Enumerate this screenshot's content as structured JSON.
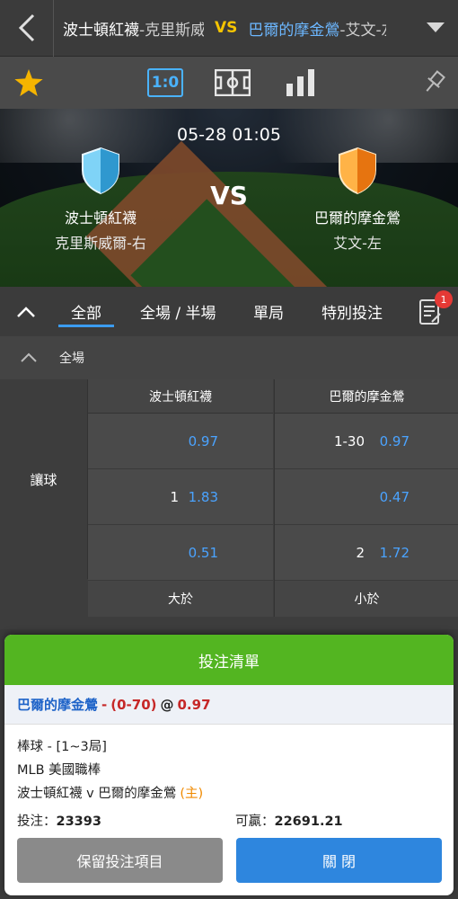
{
  "header": {
    "home_team": "波士頓紅襪",
    "home_pitcher": "-克里斯威爾",
    "vs": "VS",
    "away_team": "巴爾的摩金鶯",
    "away_pitcher": "-艾文-左",
    "back_icon": "chevron-left-icon",
    "dropdown_icon": "caret-down-icon"
  },
  "toolbar": {
    "favorite_icon": "star-icon",
    "score_label": "1:0",
    "field_icon": "field-icon",
    "stats_icon": "bar-chart-icon",
    "pin_icon": "pin-icon"
  },
  "match": {
    "datetime": "05-28 01:05",
    "vs": "VS",
    "home": {
      "name": "波士頓紅襪",
      "pitcher": "克里斯威爾-右",
      "color": "#3aa9e0"
    },
    "away": {
      "name": "巴爾的摩金鶯",
      "pitcher": "艾文-左",
      "color": "#f08a1e"
    }
  },
  "tabs": {
    "items": [
      "全部",
      "全場 / 半場",
      "單局",
      "特別投注"
    ],
    "active_index": 0,
    "betslip_count": "1"
  },
  "section": {
    "title": "全場",
    "market": "讓球",
    "home_header": "波士頓紅襪",
    "away_header": "巴爾的摩金鶯",
    "rows": [
      {
        "home_line": "",
        "home_price": "0.97",
        "away_line": "1-30",
        "away_price": "0.97"
      },
      {
        "home_line": "1",
        "home_price": "1.83",
        "away_line": "",
        "away_price": "0.47"
      },
      {
        "home_line": "",
        "home_price": "0.51",
        "away_line": "2",
        "away_price": "1.72"
      }
    ],
    "over_label": "大於",
    "under_label": "小於"
  },
  "betslip": {
    "title": "投注清單",
    "selection_team": "巴爾的摩金鶯",
    "selection_dash": "-",
    "selection_handicap": "(0-70)",
    "selection_at": "@",
    "selection_price": "0.97",
    "sport_line": "棒球 - [1~3局]",
    "league_line": "MLB 美國職棒",
    "matchup_line": "波士頓紅襪 v 巴爾的摩金鶯",
    "home_mark": "(主)",
    "stake_label": "投注：",
    "stake_value": "23393",
    "win_label": "可贏：",
    "win_value": "22691.21",
    "keep_button": "保留投注項目",
    "close_button": "關 閉"
  }
}
